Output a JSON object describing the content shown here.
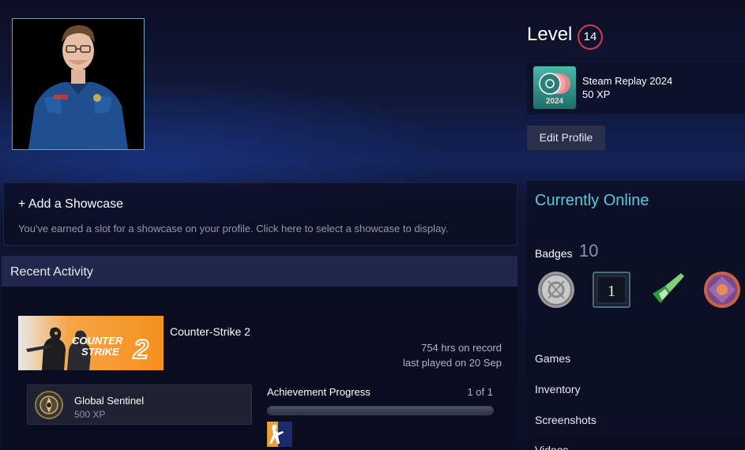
{
  "profile": {
    "level_label": "Level",
    "level_value": "14",
    "replay": {
      "title": "Steam Replay 2024",
      "xp": "50 XP",
      "icon_year": "2024"
    },
    "edit_label": "Edit Profile"
  },
  "showcase": {
    "title": "+ Add a Showcase",
    "description": "You've earned a slot for a showcase on your profile. Click here to select a showcase to display."
  },
  "recent": {
    "title": "Recent Activity",
    "game": {
      "name": "Counter-Strike 2",
      "hours": "754 hrs on record",
      "last_played": "last played on 20 Sep",
      "banner_line1": "COUNTER",
      "banner_line2": "STRIKE",
      "banner_num": "2"
    },
    "achievement": {
      "name": "Global Sentinel",
      "xp": "500 XP"
    },
    "progress": {
      "label": "Achievement Progress",
      "count": "1 of 1",
      "fraction": 1.0
    }
  },
  "sidebar": {
    "status": "Currently Online",
    "badges_label": "Badges",
    "badges_count": "10",
    "badge_year_number": "1",
    "links": [
      "Games",
      "Inventory",
      "Screenshots",
      "Videos"
    ]
  },
  "colors": {
    "online": "#57cbde",
    "level_ring": "#d23a52",
    "banner_orange": "#f5901e"
  }
}
